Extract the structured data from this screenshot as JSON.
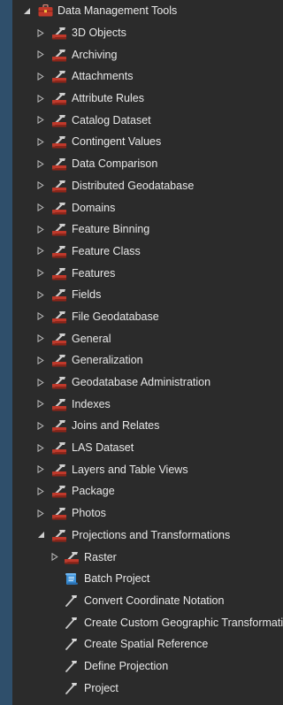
{
  "root": {
    "label": "Data Management Tools",
    "icon": "toolbox-icon"
  },
  "toolsets": [
    "3D Objects",
    "Archiving",
    "Attachments",
    "Attribute Rules",
    "Catalog Dataset",
    "Contingent Values",
    "Data Comparison",
    "Distributed Geodatabase",
    "Domains",
    "Feature Binning",
    "Feature Class",
    "Features",
    "Fields",
    "File Geodatabase",
    "General",
    "Generalization",
    "Geodatabase Administration",
    "Indexes",
    "Joins and Relates",
    "LAS Dataset",
    "Layers and Table Views",
    "Package",
    "Photos"
  ],
  "expanded_toolset": {
    "label": "Projections and Transformations",
    "children_toolsets": [
      "Raster"
    ],
    "tools": [
      {
        "label": "Batch Project",
        "icon": "script-icon"
      },
      {
        "label": "Convert Coordinate Notation",
        "icon": "hammer-icon"
      },
      {
        "label": "Create Custom Geographic Transformation",
        "icon": "hammer-icon"
      },
      {
        "label": "Create Spatial Reference",
        "icon": "hammer-icon"
      },
      {
        "label": "Define Projection",
        "icon": "hammer-icon"
      },
      {
        "label": "Project",
        "icon": "hammer-icon"
      }
    ]
  },
  "colors": {
    "background": "#2b2b2b",
    "left_strip": "#2f4f6b",
    "text": "#e8e8e8",
    "toolbox_red": "#c0392b",
    "toolset_gray": "#c9c9c9",
    "script_blue": "#3a8fd6"
  }
}
